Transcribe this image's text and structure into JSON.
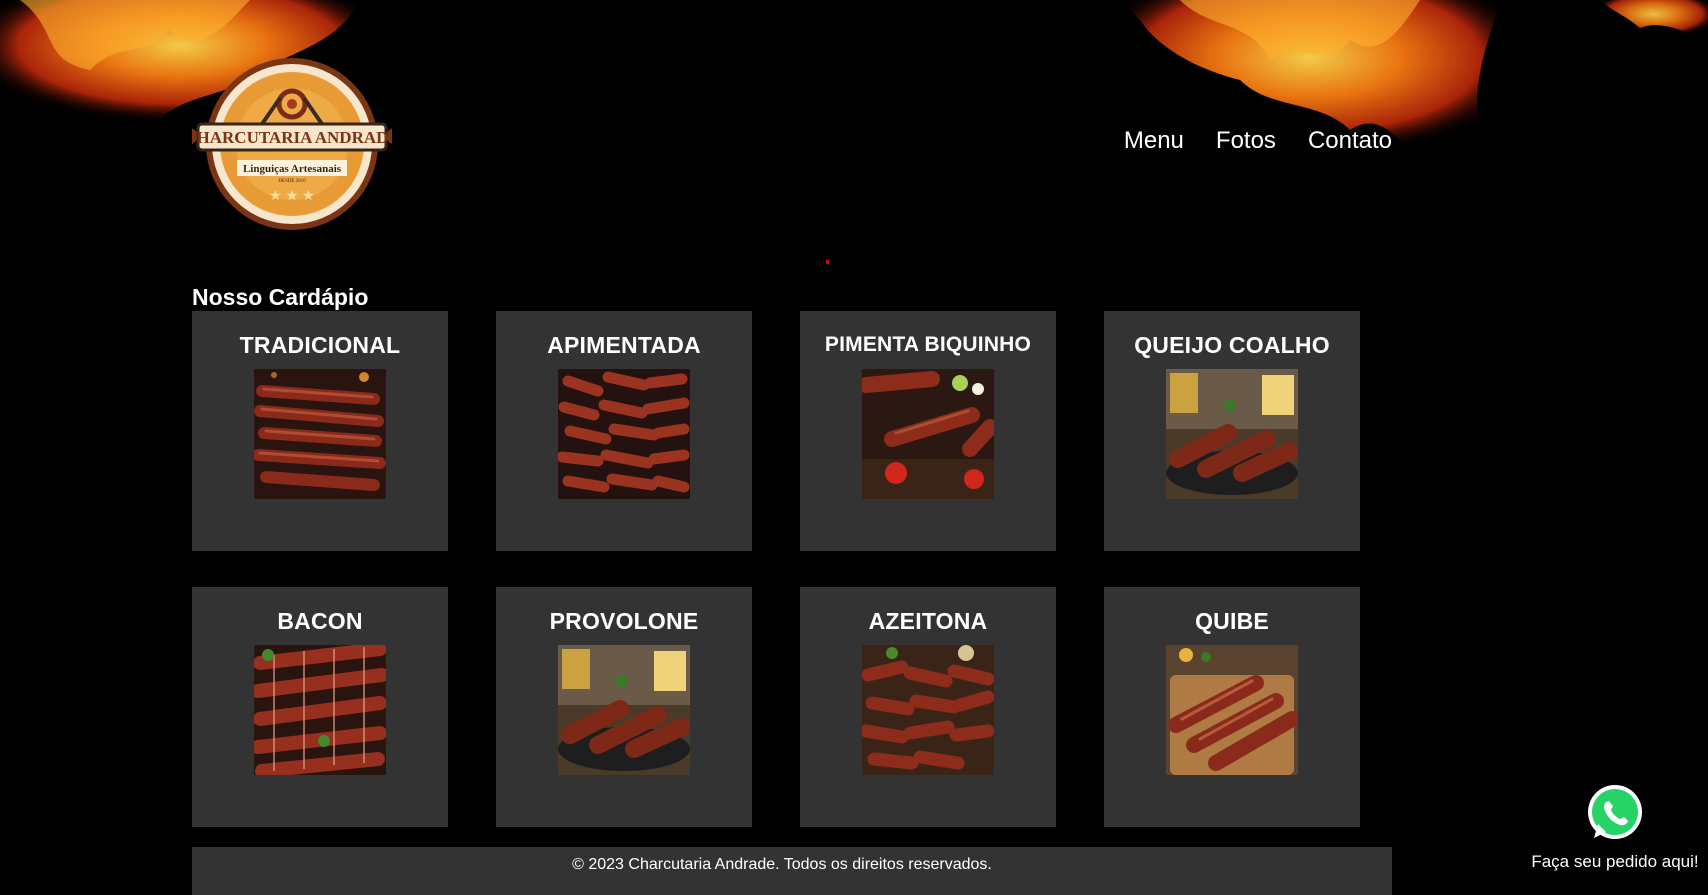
{
  "brand": {
    "name": "CHARCUTARIA ANDRADE",
    "tagline": "Linguiças Artesanais",
    "since": "DESDE 2010"
  },
  "nav": {
    "items": [
      "Menu",
      "Fotos",
      "Contato"
    ]
  },
  "menu": {
    "title": "Nosso Cardápio",
    "items": [
      {
        "name": "TRADICIONAL"
      },
      {
        "name": "APIMENTADA"
      },
      {
        "name": "PIMENTA BIQUINHO"
      },
      {
        "name": "QUEIJO COALHO"
      },
      {
        "name": "BACON"
      },
      {
        "name": "PROVOLONE"
      },
      {
        "name": "AZEITONA"
      },
      {
        "name": "QUIBE"
      }
    ]
  },
  "footer": {
    "text": "© 2023 Charcutaria Andrade. Todos os direitos reservados."
  },
  "whatsapp": {
    "label": "Faça seu pedido aqui!",
    "icon": "whatsapp-icon",
    "color": "#25D366"
  },
  "colors": {
    "background": "#000000",
    "card": "#333333",
    "text": "#ffffff",
    "accent": "#e8902a"
  }
}
